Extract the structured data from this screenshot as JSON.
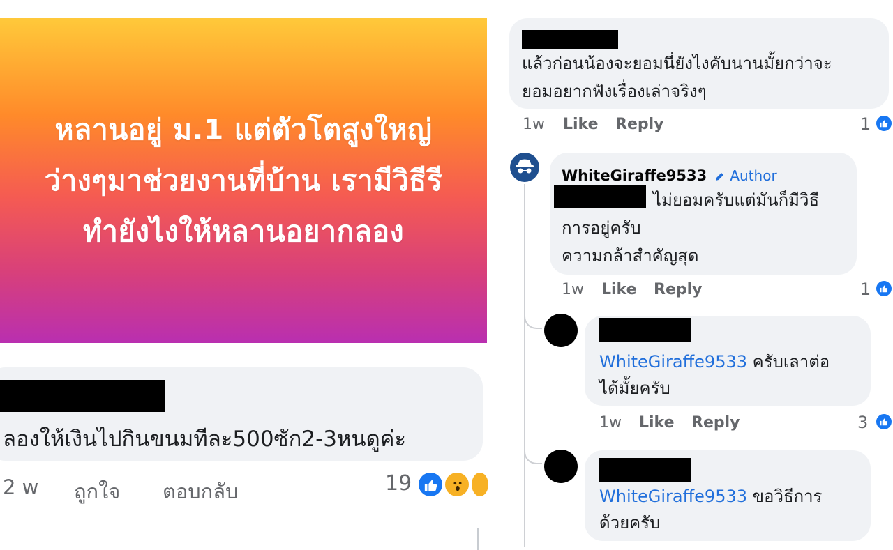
{
  "post": {
    "banner_text": "หลานอยู่ ม.1 แต่ตัวโตสูงใหญ่ ว่างๆมาช่วยงานที่บ้าน เรามีวิธีรีทำยังไงให้หลานอยากลอง",
    "comment": {
      "text": "ลองให้เงินไปกินขนมทีละ500ซัก2-3หนดูค่ะ",
      "time": "2 w",
      "like_label": "ถูกใจ",
      "reply_label": "ตอบกลับ",
      "reaction_count": "19",
      "reactions": [
        "like-icon",
        "wow-icon",
        "care-icon"
      ]
    }
  },
  "thread": {
    "comment1": {
      "text_line1": "แล้วก่อนน้องจะยอมนี่ยังไงคับนานมั้ยกว่าจะ",
      "text_line2": "ยอมอยากฟังเรื่องเล่าจริงๆ",
      "time": "1w",
      "like_label": "Like",
      "reply_label": "Reply",
      "like_count": "1"
    },
    "author_reply": {
      "name": "WhiteGiraffe9533",
      "badge": "Author",
      "text_line1": "ไม่ยอมครับแต่มันก็มีวิธี",
      "text_line2": "การอยู่ครับ",
      "text_line3": "ความกล้าสำคัญสุด",
      "time": "1w",
      "like_label": "Like",
      "reply_label": "Reply",
      "like_count": "1"
    },
    "reply1": {
      "mention": "WhiteGiraffe9533",
      "text_line1": " ครับเลาต่อ",
      "text_line2": "ได้มั้ยครับ",
      "time": "1w",
      "like_label": "Like",
      "reply_label": "Reply",
      "like_count": "3"
    },
    "reply2": {
      "mention": "WhiteGiraffe9533",
      "text_line1": " ขอวิธีการ",
      "text_line2": "ด้วยครับ"
    }
  },
  "colors": {
    "link_blue": "#216fdb",
    "like_blue": "#1877f2",
    "bubble_gray": "#f0f2f5",
    "meta_gray": "#65676b"
  }
}
